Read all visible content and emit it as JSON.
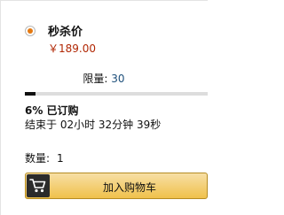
{
  "deal": {
    "label": "秒杀价",
    "price": "￥189.00",
    "selected": true,
    "accent_color": "#e47911",
    "price_color": "#b12704"
  },
  "limit": {
    "label": "限量:",
    "value": "30"
  },
  "claim": {
    "percent": 6,
    "claimed_text": "6% 已订购",
    "ends_text": "结束于 02小时 32分钟 39秒"
  },
  "quantity": {
    "label": "数量:",
    "value": "1"
  },
  "cart_button": {
    "label": "加入购物车",
    "icon": "cart-icon"
  }
}
